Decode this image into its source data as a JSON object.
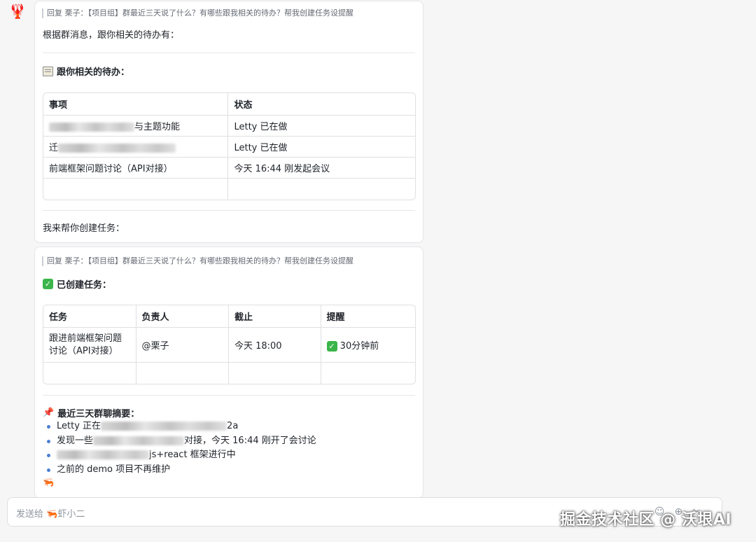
{
  "avatar_icon": "lobster-icon",
  "card1": {
    "reply_quote": "回复 栗子：【项目组】群最近三天说了什么？有哪些跟我相关的待办？帮我创建任务设提醒",
    "intro": "根据群消息，跟你相关的待办有：",
    "section_title": "跟你相关的待办：",
    "section_icon": "memo-icon",
    "table": {
      "headers": [
        "事项",
        "状态"
      ],
      "rows": [
        {
          "item_suffix": "与主题功能",
          "status": "Letty 已在做"
        },
        {
          "item_prefix": "迁",
          "status": "Letty 已在做"
        },
        {
          "item": "前端框架问题讨论（API对接）",
          "status": "今天 16:44 刚发起会议"
        }
      ]
    },
    "closing": "我来帮你创建任务："
  },
  "card2": {
    "reply_quote": "回复 栗子：【项目组】群最近三天说了什么？有哪些跟我相关的待办？帮我创建任务设提醒",
    "section_title": "已创建任务：",
    "section_icon": "check-icon",
    "table": {
      "headers": [
        "任务",
        "负责人",
        "截止",
        "提醒"
      ],
      "row": {
        "task": "跟进前端框架问题讨论（API对接）",
        "owner": "@栗子",
        "due": "今天 18:00",
        "reminder": "30分钟前"
      }
    },
    "summary_title": "最近三天群聊摘要：",
    "summary_icon": "pushpin-icon",
    "summary": {
      "item1_prefix": "Letty 正在",
      "item1_suffix": "2a",
      "item2_prefix": "发现一些",
      "item2_suffix": "对接，今天 16:44 刚开了会讨论",
      "item3_suffix": "js+react 框架进行中",
      "item4": "之前的 demo 项目不再维护"
    }
  },
  "composer": {
    "placeholder_prefix": "发送给",
    "bot_name": "虾小二"
  },
  "watermark": "掘金技术社区 @ 沃垠AI"
}
